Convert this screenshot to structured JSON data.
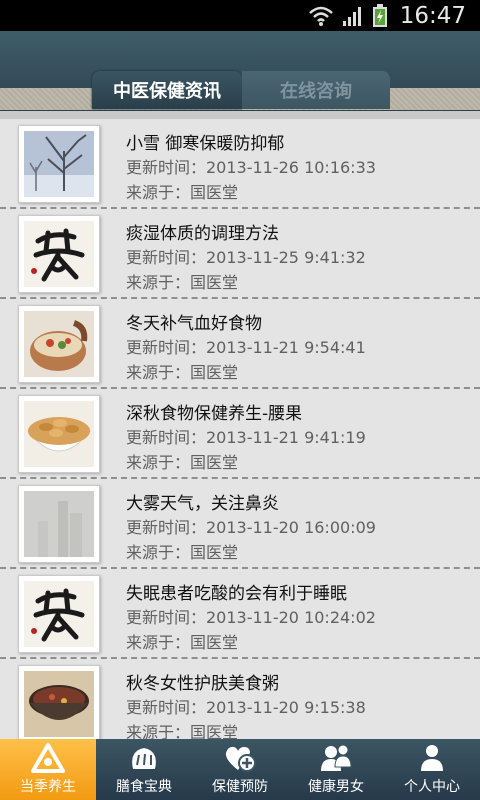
{
  "status": {
    "time": "16:47"
  },
  "tabs": [
    {
      "label": "中医保健资讯"
    },
    {
      "label": "在线咨询"
    }
  ],
  "items": [
    {
      "title": "小雪 御寒保暖防抑郁",
      "time": "更新时间：2013-11-26 10:16:33",
      "source": "来源于：国医堂",
      "thumb": "snowy-tree-icon"
    },
    {
      "title": "痰湿体质的调理方法",
      "time": "更新时间：2013-11-25 9:41:32",
      "source": "来源于：国医堂",
      "thumb": "tea-calligraphy-icon"
    },
    {
      "title": "冬天补气血好食物",
      "time": "更新时间：2013-11-21 9:54:41",
      "source": "来源于：国医堂",
      "thumb": "soup-pot-icon"
    },
    {
      "title": "深秋食物保健养生-腰果",
      "time": "更新时间：2013-11-21 9:41:19",
      "source": "来源于：国医堂",
      "thumb": "cashew-bowl-icon"
    },
    {
      "title": "大雾天气，关注鼻炎",
      "time": "更新时间：2013-11-20 16:00:09",
      "source": "来源于：国医堂",
      "thumb": "foggy-city-icon"
    },
    {
      "title": "失眠患者吃酸的会有利于睡眠",
      "time": "更新时间：2013-11-20 10:24:02",
      "source": "来源于：国医堂",
      "thumb": "tea-calligraphy-icon"
    },
    {
      "title": "秋冬女性护肤美食粥",
      "time": "更新时间：2013-11-20 9:15:38",
      "source": "来源于：国医堂",
      "thumb": "porridge-bowl-icon"
    }
  ],
  "nav": [
    {
      "label": "当季养生",
      "icon": "season-triangle-icon",
      "active": true
    },
    {
      "label": "膳食宝典",
      "icon": "bread-icon",
      "active": false
    },
    {
      "label": "保健预防",
      "icon": "heart-plus-icon",
      "active": false
    },
    {
      "label": "健康男女",
      "icon": "couple-icon",
      "active": false
    },
    {
      "label": "个人中心",
      "icon": "person-icon",
      "active": false
    }
  ]
}
